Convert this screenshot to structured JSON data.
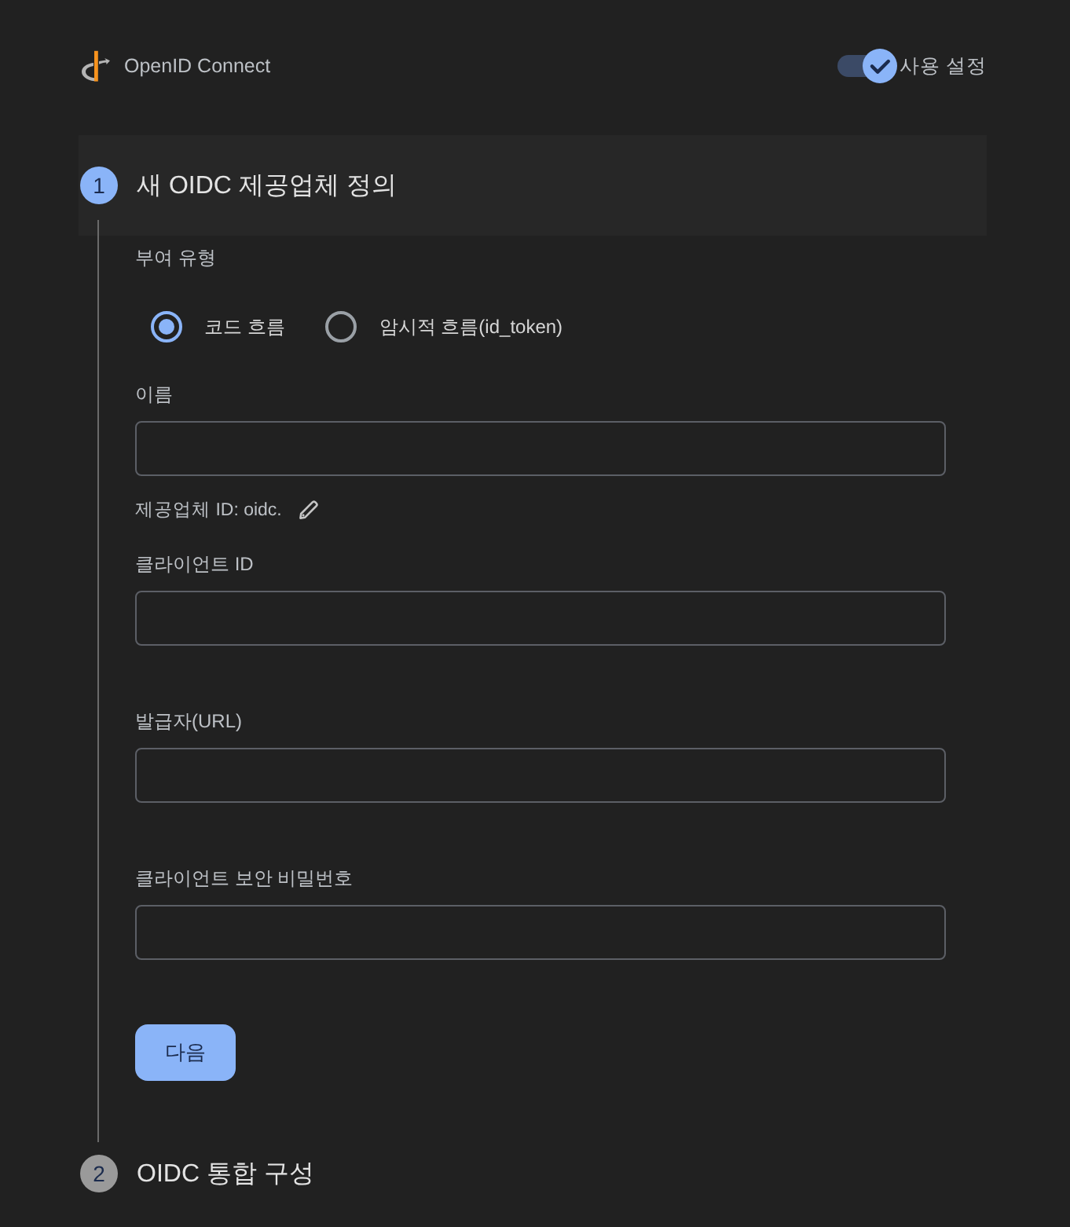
{
  "header": {
    "title": "OpenID Connect",
    "toggle": {
      "label": "사용 설정",
      "on": true
    }
  },
  "steps": [
    {
      "number": "1",
      "title": "새 OIDC 제공업체 정의",
      "selected": true,
      "form": {
        "grant_type": {
          "label": "부여 유형",
          "options": [
            {
              "label": "코드 흐름",
              "selected": true
            },
            {
              "label": "암시적 흐름(id_token)",
              "selected": false
            }
          ]
        },
        "fields": [
          {
            "label": "이름",
            "helper": "제공업체 ID: oidc."
          },
          {
            "label": "클라이언트 ID"
          },
          {
            "label": "발급자(URL)"
          },
          {
            "label": "클라이언트 보안 비밀번호"
          }
        ],
        "next_button": "다음"
      }
    },
    {
      "number": "2",
      "title": "OIDC 통합 구성",
      "selected": false
    }
  ]
}
